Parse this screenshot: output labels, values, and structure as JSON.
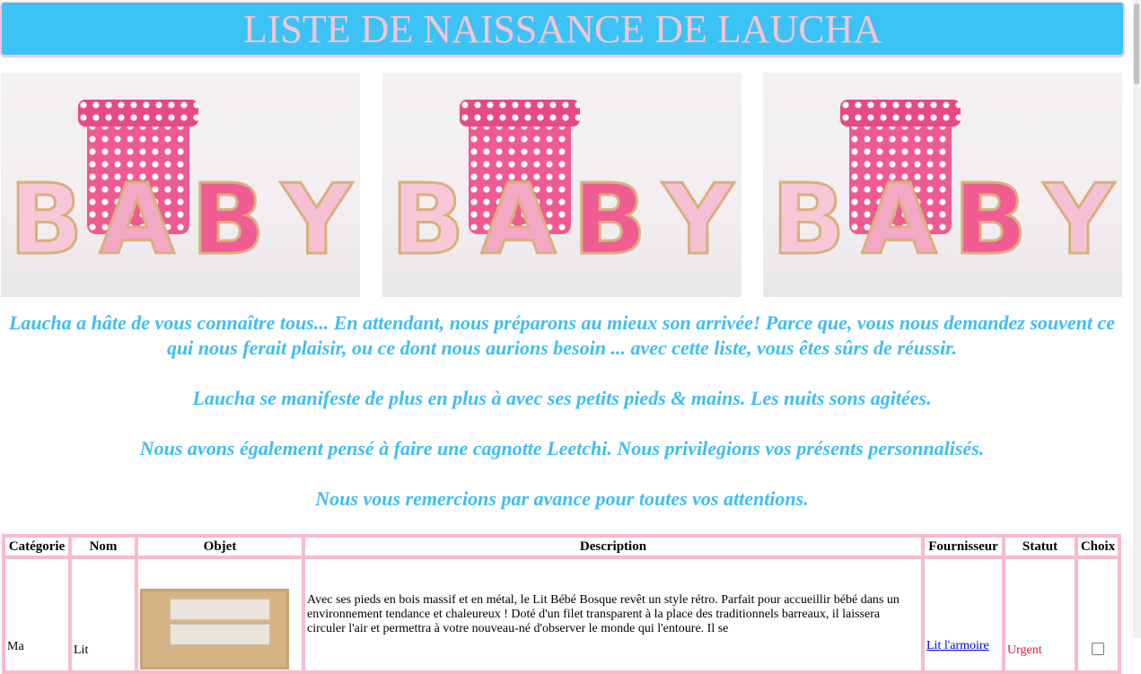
{
  "header": {
    "title": "LISTE DE NAISSANCE DE LAUCHA"
  },
  "photos": [
    {
      "alt": "BABY",
      "letters": [
        "B",
        "A",
        "B",
        "Y"
      ]
    },
    {
      "alt": "BABY",
      "letters": [
        "B",
        "A",
        "B",
        "Y"
      ]
    },
    {
      "alt": "BABY",
      "letters": [
        "B",
        "A",
        "B",
        "Y"
      ]
    }
  ],
  "intro": {
    "p1": "Laucha a hâte de vous connaître tous... En attendant, nous préparons au mieux son arrivée! Parce que, vous nous demandez souvent ce qui nous ferait plaisir, ou ce dont nous aurions besoin ... avec cette liste, vous êtes sûrs de réussir.",
    "p2": "Laucha se manifeste de plus en plus à avec ses petits pieds & mains. Les nuits sons agitées.",
    "p3": "Nous avons également pensé à faire une cagnotte Leetchi. Nous privilegions vos présents personnalisés.",
    "p4": "Nous vous remercions par avance pour toutes vos attentions."
  },
  "table": {
    "headers": [
      "Catégorie",
      "Nom",
      "Objet",
      "Description",
      "Fournisseur",
      "Statut",
      "Choix"
    ],
    "rows": [
      {
        "categorie": "Ma",
        "nom": "Lit",
        "description": "Avec ses pieds en bois massif et en métal, le Lit Bébé Bosque revêt un style rétro. Parfait pour accueillir bébé dans un environnement tendance et chaleureux ! Doté d'un filet transparent à la place des traditionnels barreaux, il laissera circuler l'air et permettra à votre nouveau-né d'observer le monde qui l'entoure. Il se",
        "fournisseur": "Lit l'armoire",
        "statut": "Urgent"
      }
    ]
  },
  "colors": {
    "header_bg": "#3cc3f6",
    "header_text": "#f5c4d4",
    "intro_text": "#3ebdf2",
    "table_border": "#f7bccc",
    "urgent": "#e0143c"
  }
}
